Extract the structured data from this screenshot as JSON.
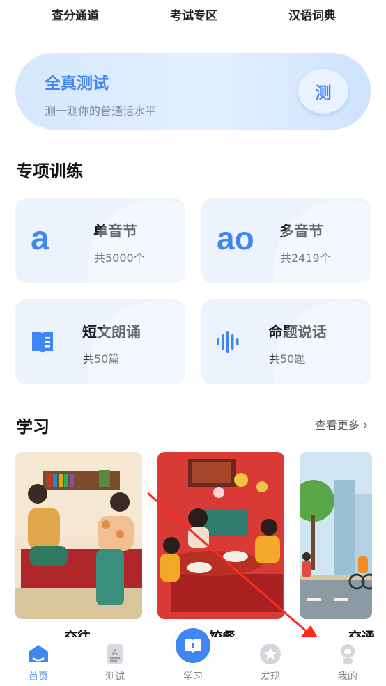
{
  "top_links": [
    "查分通道",
    "考试专区",
    "汉语词典"
  ],
  "hero": {
    "title": "全真测试",
    "subtitle": "测一测你的普通话水平",
    "button_label": "测"
  },
  "special_training": {
    "title": "专项训练",
    "cards": [
      {
        "glyph": "a",
        "title": "单音节",
        "count": "共5000个"
      },
      {
        "glyph": "ao",
        "title": "多音节",
        "count": "共2419个"
      },
      {
        "glyph": "book-icon",
        "title": "短文朗诵",
        "count": "共50篇"
      },
      {
        "glyph": "waveform-icon",
        "title": "命题说话",
        "count": "共50题"
      }
    ]
  },
  "study": {
    "title": "学习",
    "more_label": "查看更多",
    "captions": [
      "交往",
      "饺餐",
      "交通"
    ]
  },
  "tabbar": {
    "items": [
      {
        "label": "首页",
        "icon": "home-icon",
        "active": true
      },
      {
        "label": "测试",
        "icon": "test-doc-icon",
        "active": false
      },
      {
        "label": "学习",
        "icon": "book-icon",
        "active": false
      },
      {
        "label": "发现",
        "icon": "star-icon",
        "active": false
      },
      {
        "label": "我的",
        "icon": "user-icon",
        "active": false
      }
    ]
  },
  "colors": {
    "accent": "#3f86f3",
    "card_bg": "#edf3fd",
    "arrow": "#ff2a1f"
  }
}
